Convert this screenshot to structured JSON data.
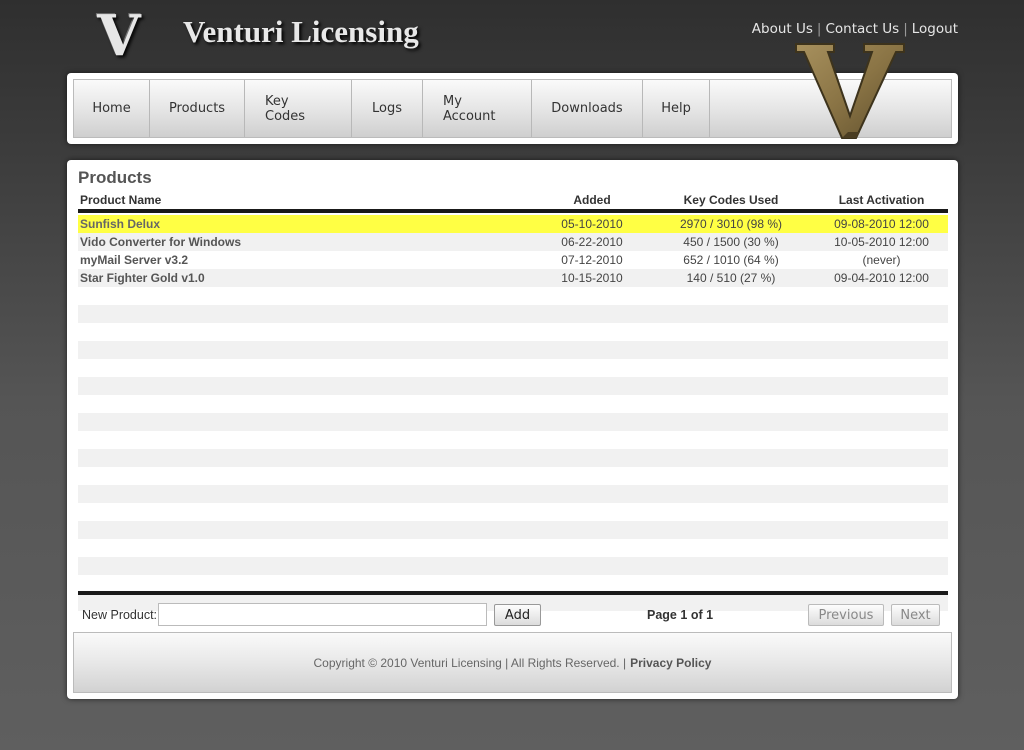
{
  "header": {
    "logo_letter": "V",
    "title": "Venturi Licensing",
    "links": [
      "About Us",
      "Contact Us",
      "Logout"
    ],
    "separator": "|"
  },
  "nav": {
    "items": [
      "Home",
      "Products",
      "Key Codes",
      "Logs",
      "My Account",
      "Downloads",
      "Help"
    ]
  },
  "main": {
    "title": "Products",
    "columns": [
      "Product Name",
      "Added",
      "Key Codes Used",
      "Last Activation"
    ],
    "rows": [
      {
        "name": "Sunfish Delux",
        "added": "05-10-2010",
        "used": "2970 / 3010 (98 %)",
        "last": "09-08-2010 12:00",
        "selected": true
      },
      {
        "name": "Vido Converter for Windows",
        "added": "06-22-2010",
        "used": "450 / 1500 (30 %)",
        "last": "10-05-2010 12:00"
      },
      {
        "name": "myMail Server v3.2",
        "added": "07-12-2010",
        "used": "652 / 1010 (64 %)",
        "last": "(never)"
      },
      {
        "name": "Star Fighter Gold v1.0",
        "added": "10-15-2010",
        "used": "140 / 510 (27 %)",
        "last": "09-04-2010 12:00"
      }
    ],
    "highlight_color": "#ffff44",
    "new_product_label": "New Product:",
    "new_product_value": "",
    "add_label": "Add",
    "page_prefix": "Page",
    "page_current": "1",
    "page_of": "of",
    "page_total": "1",
    "previous_label": "Previous",
    "next_label": "Next"
  },
  "footer": {
    "copyright": "Copyright © 2010 Venturi Licensing | All Rights Reserved. |",
    "privacy": "Privacy Policy"
  }
}
